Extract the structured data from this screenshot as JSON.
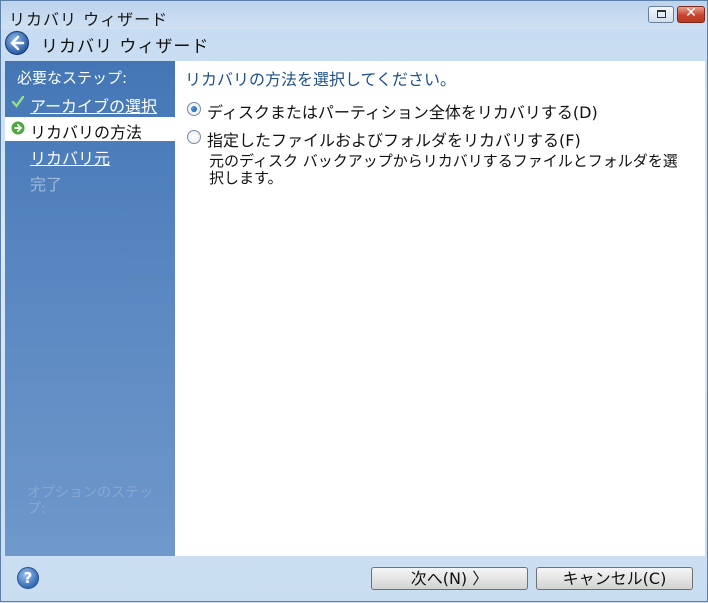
{
  "window": {
    "title": "リカバリ ウィザード"
  },
  "header": {
    "title": "リカバリ ウィザード"
  },
  "sidebar": {
    "heading": "必要なステップ:",
    "steps": [
      {
        "label": "アーカイブの選択",
        "state": "completed"
      },
      {
        "label": "リカバリの方法",
        "state": "current"
      },
      {
        "label": "リカバリ元",
        "state": "pending"
      },
      {
        "label": "完了",
        "state": "disabled"
      }
    ],
    "faded_text": "オプションのステップ:"
  },
  "content": {
    "heading": "リカバリの方法を選択してください。",
    "options": [
      {
        "label": "ディスクまたはパーティション全体をリカバリする(D)",
        "selected": true
      },
      {
        "label": "指定したファイルおよびフォルダをリカバリする(F)",
        "selected": false
      }
    ],
    "description": "元のディスク バックアップからリカバリするファイルとフォルダを選択します。"
  },
  "footer": {
    "next_label": "次へ(N) 〉",
    "cancel_label": "キャンセル(C)"
  },
  "colors": {
    "sidebar": "#5584c0",
    "heading_text": "#1e4f8f",
    "close_button": "#c94430"
  },
  "icons": [
    "back-arrow-icon",
    "check-icon",
    "arrow-right-icon",
    "help-icon",
    "restore-icon",
    "close-icon"
  ]
}
